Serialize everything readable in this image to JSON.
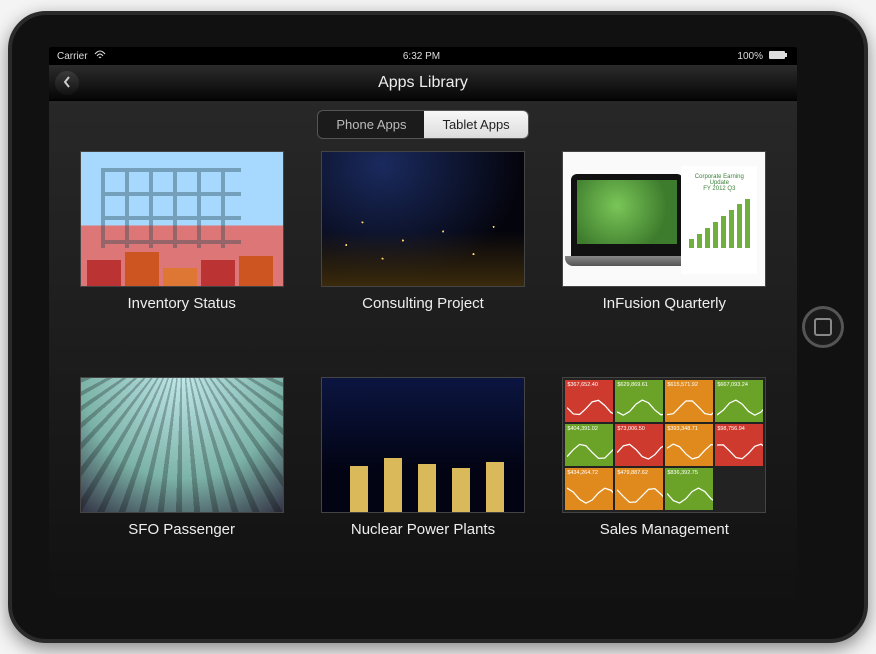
{
  "status_bar": {
    "carrier": "Carrier",
    "wifi_icon": "wifi",
    "time": "6:32 PM",
    "battery_pct": "100%",
    "battery_icon": "battery-full"
  },
  "nav": {
    "title": "Apps Library",
    "back_icon": "chevron-left"
  },
  "segment": {
    "items": [
      {
        "label": "Phone Apps",
        "active": false
      },
      {
        "label": "Tablet Apps",
        "active": true
      }
    ]
  },
  "apps": [
    {
      "label": "Inventory Status",
      "thumb": "port"
    },
    {
      "label": "Consulting Project",
      "thumb": "night-city"
    },
    {
      "label": "InFusion Quarterly",
      "thumb": "laptop",
      "laptop_text": {
        "line1": "Corporate Earning",
        "line2": "Update",
        "line3": "FY 2012 Q3"
      }
    },
    {
      "label": "SFO Passenger",
      "thumb": "arch"
    },
    {
      "label": "Nuclear Power Plants",
      "thumb": "nuclear"
    },
    {
      "label": "Sales Management",
      "thumb": "dashboard",
      "tiles": [
        {
          "color": "#cf3a2e",
          "value": "$367,652.40"
        },
        {
          "color": "#6aa328",
          "value": "$629,869.61"
        },
        {
          "color": "#e08a1e",
          "value": "$615,571.92"
        },
        {
          "color": "#6aa328",
          "value": "$667,093.24"
        },
        {
          "color": "#6aa328",
          "value": "$404,391.02"
        },
        {
          "color": "#cf3a2e",
          "value": "$73,006.50"
        },
        {
          "color": "#e08a1e",
          "value": "$393,348.71"
        },
        {
          "color": "#cf3a2e",
          "value": "$98,756.94"
        },
        {
          "color": "#e08a1e",
          "value": "$434,264.72"
        },
        {
          "color": "#e08a1e",
          "value": "$479,887.62"
        },
        {
          "color": "#6aa328",
          "value": "$836,392.75"
        }
      ]
    }
  ]
}
